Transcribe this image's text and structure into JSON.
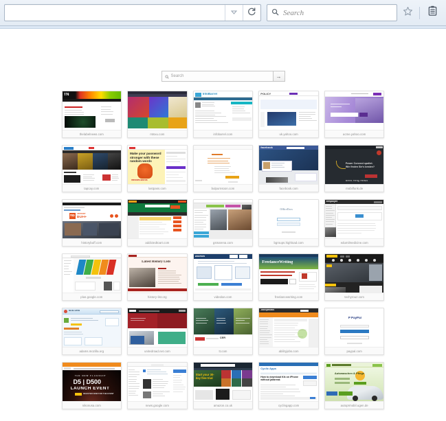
{
  "browser": {
    "url_value": "",
    "url_dropdown_icon": "chevron-down-icon",
    "reload_icon": "reload-icon",
    "search": {
      "placeholder": "Search",
      "icon": "search-icon"
    },
    "bookmark_icon": "star-icon",
    "reading_list_icon": "reading-list-icon"
  },
  "newtab": {
    "search": {
      "placeholder": "Search",
      "icon": "search-icon",
      "go_label": "→"
    },
    "tiles": [
      {
        "label": "thelabelnews.com",
        "theme": "tn"
      },
      {
        "label": "mtsxu.com",
        "theme": "colorgrid"
      },
      {
        "label": "infobarrel.com",
        "theme": "infobarrel"
      },
      {
        "label": "uk.yahoo.com",
        "theme": "policy"
      },
      {
        "label": "acme.yahoo.com",
        "theme": "purplehero"
      },
      {
        "label": "tapcay.com",
        "theme": "newsgrid"
      },
      {
        "label": "lastpass.com",
        "theme": "password"
      },
      {
        "label": "bulpurnsoon.com",
        "theme": "plaindoc"
      },
      {
        "label": "facebook.com",
        "theme": "facebook"
      },
      {
        "label": "mobilfunk.de",
        "theme": "darkhero"
      },
      {
        "label": "historybuff.com",
        "theme": "historybuff"
      },
      {
        "label": "addictedtoart.com",
        "theme": "greenstats"
      },
      {
        "label": "gsmarena.com",
        "theme": "gsmarena"
      },
      {
        "label": "bgroups.highload.com",
        "theme": "loginplain"
      },
      {
        "label": "edumilmedicine.com",
        "theme": "employer"
      },
      {
        "label": "plus.google.com",
        "theme": "rainbow"
      },
      {
        "label": "history-list.org",
        "theme": "historylist"
      },
      {
        "label": "videolan.com",
        "theme": "wikihow"
      },
      {
        "label": "freelancewriting.com",
        "theme": "freelance"
      },
      {
        "label": "techyrouz.com",
        "theme": "darkplayer"
      },
      {
        "label": "adams.mozilla.org",
        "theme": "addons"
      },
      {
        "label": "unitedroad.net.com",
        "theme": "redpanels"
      },
      {
        "label": "tt.com",
        "theme": "greenmap"
      },
      {
        "label": "abilityjobs.com",
        "theme": "orangeportal"
      },
      {
        "label": "paypal.com",
        "theme": "paypal"
      },
      {
        "label": "nikonusa.com",
        "theme": "nikond500"
      },
      {
        "label": "news.google.com",
        "theme": "newsfeed"
      },
      {
        "label": "amazon.co.uk",
        "theme": "amazon"
      },
      {
        "label": "cyclingapp.com",
        "theme": "cyclicapps"
      },
      {
        "label": "autoprmobil.ugen.de",
        "theme": "carsite"
      }
    ]
  },
  "colors": {
    "chrome_bg": "#e7eef7",
    "content_bg": "#ffffff",
    "tile_border": "#e0e0e0",
    "label_text": "#8a8a8a"
  }
}
